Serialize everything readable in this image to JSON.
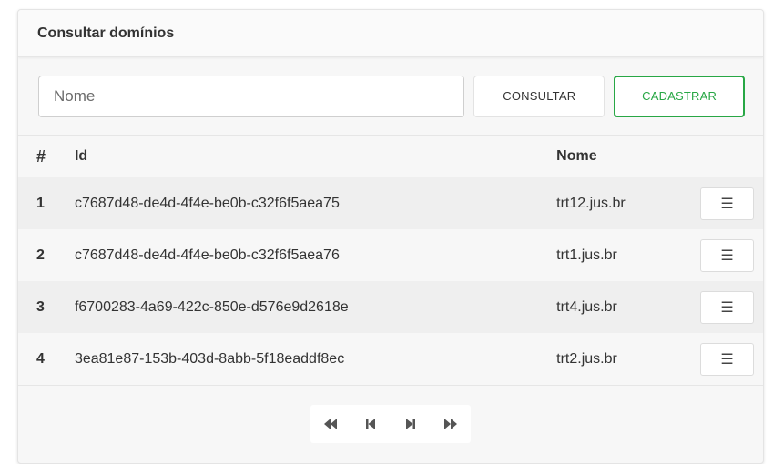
{
  "header": {
    "title": "Consultar domínios"
  },
  "search": {
    "placeholder": "Nome",
    "consultar_label": "CONSULTAR",
    "cadastrar_label": "CADASTRAR"
  },
  "table": {
    "columns": [
      "#",
      "Id",
      "Nome"
    ],
    "rows": [
      {
        "num": "1",
        "id": "c7687d48-de4d-4f4e-be0b-c32f6f5aea75",
        "nome": "trt12.jus.br"
      },
      {
        "num": "2",
        "id": "c7687d48-de4d-4f4e-be0b-c32f6f5aea76",
        "nome": "trt1.jus.br"
      },
      {
        "num": "3",
        "id": "f6700283-4a69-422c-850e-d576e9d2618e",
        "nome": "trt4.jus.br"
      },
      {
        "num": "4",
        "id": "3ea81e87-153b-403d-8abb-5f18eaddf8ec",
        "nome": "trt2.jus.br"
      }
    ],
    "row_action_icon": "menu-icon"
  },
  "pagination": {
    "first_icon": "first-page-icon",
    "prev_icon": "previous-page-icon",
    "next_icon": "next-page-icon",
    "last_icon": "last-page-icon"
  },
  "colors": {
    "accent": "#28a745",
    "stripe": "#efefef"
  }
}
